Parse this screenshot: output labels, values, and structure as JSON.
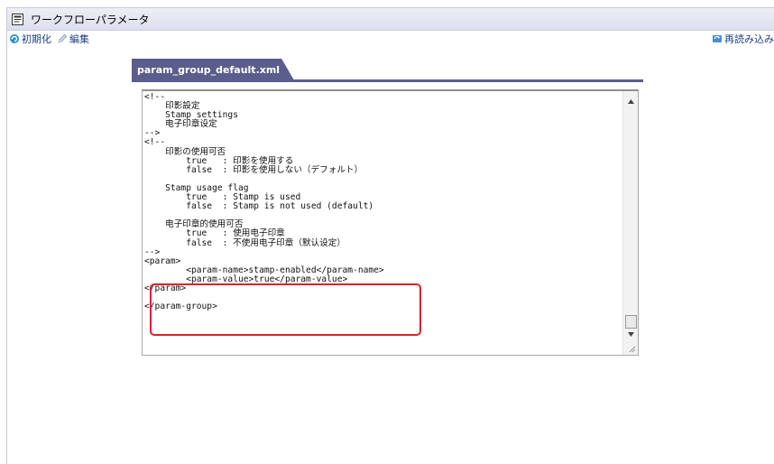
{
  "window": {
    "title": "ワークフローパラメータ"
  },
  "toolbar": {
    "init_label": "初期化",
    "edit_label": "編集",
    "reload_label": "再読み込み"
  },
  "tab": {
    "label": "param_group_default.xml"
  },
  "editor": {
    "lines": [
      "<!--",
      "    印影設定",
      "    Stamp settings",
      "    电子印章设定",
      "-->",
      "<!--",
      "    印影の使用可否",
      "        true   : 印影を使用する",
      "        false  : 印影を使用しない（デフォルト）",
      "",
      "    Stamp usage flag",
      "        true   : Stamp is used",
      "        false  : Stamp is not used (default)",
      "",
      "    电子印章的使用可否",
      "        true   : 使用电子印章",
      "        false  : 不使用电子印章（默认设定）",
      "-->",
      "<param>",
      "        <param-name>stamp-enabled</param-name>",
      "        <param-value>true</param-value>",
      "</param>",
      "",
      "</param-group>"
    ]
  },
  "colors": {
    "tab_bg": "#5b5d8c",
    "highlight": "#d9232d",
    "titlebar": "#e3e5f2"
  },
  "icons": {
    "title": "document-icon",
    "init": "refresh-icon",
    "edit": "pencil-icon",
    "reload": "reload-icon"
  }
}
